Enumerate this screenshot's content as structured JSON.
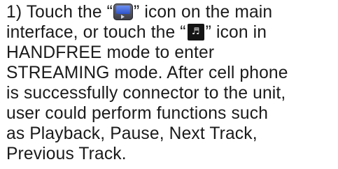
{
  "instruction": {
    "line1": {
      "before_icon": "1) Touch the “",
      "after_icon": "” icon on the main"
    },
    "line2": {
      "before_icon": "interface, or touch the “",
      "after_icon": "” icon in"
    },
    "line3": "HANDFREE mode to enter",
    "line4": "STREAMING mode. After cell phone",
    "line5": "is successfully connector to the unit,",
    "line6": "user could perform functions such",
    "line7": "as Playback, Pause, Next Track,",
    "line8": "Previous Track."
  },
  "icons": {
    "streaming_icon": "streaming-mode-icon",
    "music_icon": "music-note-icon",
    "music_glyph": "♬"
  }
}
